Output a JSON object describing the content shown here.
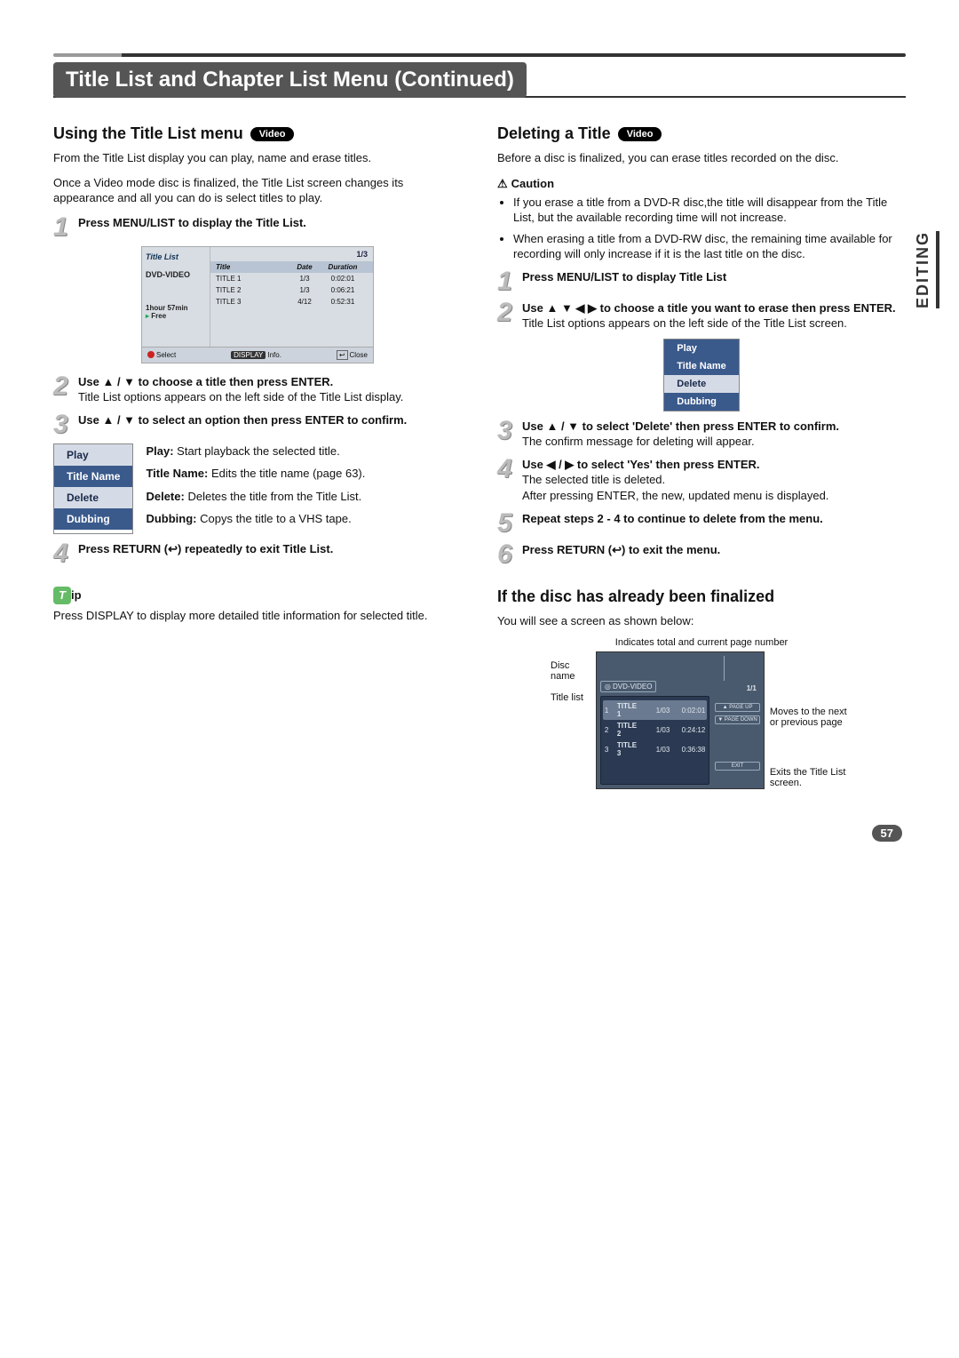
{
  "header": {
    "title": "Title List and Chapter List Menu (Continued)"
  },
  "side_tab": "EDITING",
  "badges": {
    "video": "Video"
  },
  "left": {
    "heading": "Using the Title List menu",
    "intro1": "From the Title List display you can play, name and erase titles.",
    "intro2": "Once a Video mode disc is finalized, the Title List screen changes its appearance and all you can do is select titles to play.",
    "step1": "Press MENU/LIST to display the Title List.",
    "screenshot": {
      "box_title": "Title List",
      "disc_type": "DVD-VIDEO",
      "remain": "1hour 57min",
      "free": "Free",
      "pager": "1/3",
      "cols": {
        "title": "Title",
        "date": "Date",
        "duration": "Duration"
      },
      "rows": [
        {
          "t": "TITLE 1",
          "d": "1/3",
          "du": "0:02:01"
        },
        {
          "t": "TITLE 2",
          "d": "1/3",
          "du": "0:06:21"
        },
        {
          "t": "TITLE 3",
          "d": "4/12",
          "du": "0:52:31"
        }
      ],
      "foot": {
        "select": "Select",
        "display": "DISPLAY",
        "info": "Info.",
        "close": "Close"
      }
    },
    "step2_bold": "Use ▲ / ▼ to choose a title then press ENTER.",
    "step2_body": "Title List options appears on the left side of the Title List display.",
    "step3_bold": "Use ▲ / ▼ to select an option then press ENTER to confirm.",
    "options_menu": [
      "Play",
      "Title Name",
      "Delete",
      "Dubbing"
    ],
    "options_desc": {
      "play": "Play: Start playback the selected title.",
      "title_name": "Title Name: Edits the title name (page 63).",
      "delete": "Delete: Deletes the title from the Title List.",
      "dubbing": "Dubbing: Copys the title to a VHS tape."
    },
    "step4": "Press RETURN (↩) repeatedly to exit Title List.",
    "tip_label": "ip",
    "tip_body": "Press DISPLAY to display more detailed title information for selected title."
  },
  "right": {
    "heading": "Deleting a Title",
    "intro": "Before a disc is finalized, you can erase titles recorded on the disc.",
    "caution_label": "Caution",
    "caution_items": [
      "If you erase a title from a DVD-R disc,the title will disappear from the Title List, but the available recording time will not increase.",
      "When erasing a title from a DVD-RW disc, the remaining time available for recording will only increase if it is the last title on the disc."
    ],
    "step1": "Press MENU/LIST to display Title List",
    "step2_bold": "Use ▲ ▼ ◀ ▶ to choose a title you want to erase then press ENTER.",
    "step2_body": "Title List options appears on the left side of the Title List screen.",
    "options_menu": [
      "Play",
      "Title Name",
      "Delete",
      "Dubbing"
    ],
    "step3_bold": "Use ▲ / ▼ to select 'Delete' then press ENTER to confirm.",
    "step3_body": "The confirm message for deleting will appear.",
    "step4_bold": "Use ◀ / ▶ to select 'Yes' then press ENTER.",
    "step4_body1": "The selected title is deleted.",
    "step4_body2": "After pressing ENTER, the new, updated menu is displayed.",
    "step5": "Repeat steps 2 - 4 to continue to delete from the menu.",
    "step6": "Press RETURN (↩) to exit the menu.",
    "finalized_heading": "If the disc has already been finalized",
    "finalized_intro": "You will see a screen as shown below:",
    "fin_fig": {
      "top_caption": "Indicates total and current page number",
      "disc_name": "Disc name",
      "title_list": "Title list",
      "dvd": "DVD-VIDEO",
      "pager": "1/1",
      "rows": [
        {
          "n": "1",
          "t": "TITLE 1",
          "d": "1/03",
          "du": "0:02:01"
        },
        {
          "n": "2",
          "t": "TITLE 2",
          "d": "1/03",
          "du": "0:24:12"
        },
        {
          "n": "3",
          "t": "TITLE 3",
          "d": "1/03",
          "du": "0:36:38"
        }
      ],
      "page_up": "▲ PAGE UP",
      "page_down": "▼ PAGE DOWN",
      "exit": "EXIT",
      "note_page": "Moves to the next or previous page",
      "note_exit": "Exits the Title List screen."
    }
  },
  "page_number": "57"
}
